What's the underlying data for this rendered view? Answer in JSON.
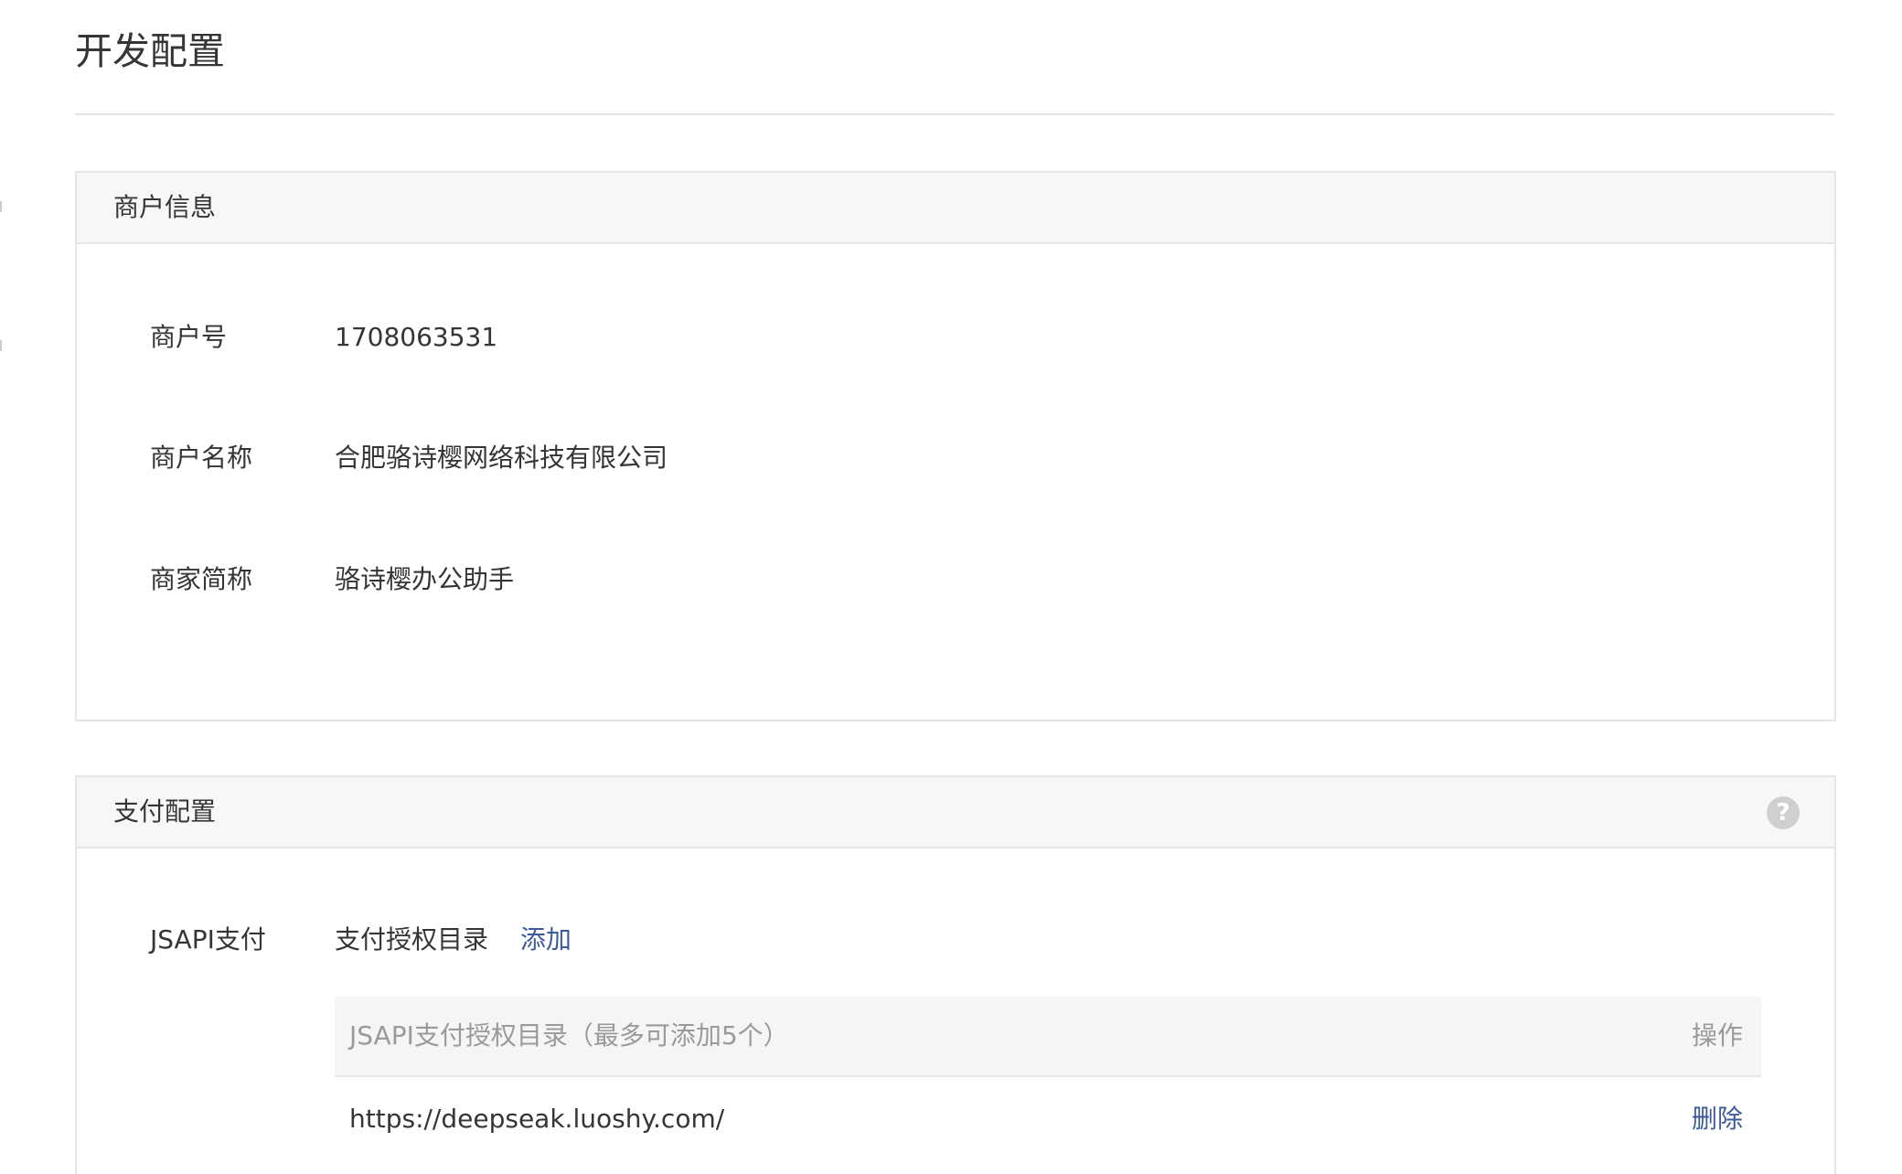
{
  "page": {
    "title": "开发配置"
  },
  "merchant_info": {
    "section_title": "商户信息",
    "fields": [
      {
        "label": "商户号",
        "value": "1708063531"
      },
      {
        "label": "商户名称",
        "value": "合肥骆诗樱网络科技有限公司"
      },
      {
        "label": "商家简称",
        "value": "骆诗樱办公助手"
      }
    ]
  },
  "payment_config": {
    "section_title": "支付配置",
    "help_icon": "question-circle-icon",
    "help_glyph": "?",
    "jsapi": {
      "label": "JSAPI支付",
      "dir_label": "支付授权目录",
      "add_link": "添加",
      "table": {
        "columns": [
          "JSAPI支付授权目录（最多可添加5个）",
          "操作"
        ],
        "rows": [
          {
            "url": "https://deepseak.luoshy.com/",
            "action": "删除"
          }
        ]
      }
    }
  },
  "colors": {
    "link": "#3c5a99",
    "header_bg": "#f7f7f7",
    "border": "#e6e6e6",
    "muted_text": "#9a9a9a"
  }
}
